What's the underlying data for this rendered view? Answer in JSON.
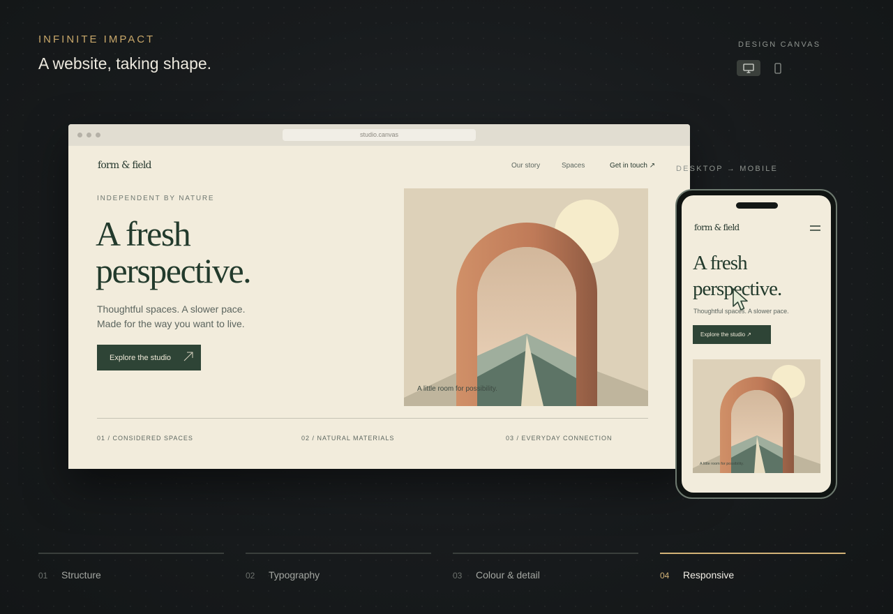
{
  "header": {
    "eyebrow": "INFINITE IMPACT",
    "headline": "A website, taking shape."
  },
  "canvas_controls": {
    "label": "DESIGN CANVAS",
    "modes": [
      {
        "icon": "desktop-icon",
        "active": true
      },
      {
        "icon": "mobile-icon",
        "active": false
      }
    ]
  },
  "desktop_preview": {
    "url": "studio.canvas",
    "site": {
      "logo": "form & field",
      "nav": [
        "Our story",
        "Spaces",
        "Get in touch ↗"
      ],
      "kicker": "INDEPENDENT BY NATURE",
      "title_line1": "A fresh",
      "title_line2": "perspective.",
      "subtitle_line1": "Thoughtful spaces. A slower pace.",
      "subtitle_line2": "Made for the way you want to live.",
      "cta": "Explore the studio",
      "caption": "A little room for possibility.",
      "features": [
        "01 / CONSIDERED SPACES",
        "02 / NATURAL MATERIALS",
        "03 / EVERYDAY CONNECTION"
      ]
    }
  },
  "transition_label": "DESKTOP → MOBILE",
  "mobile_preview": {
    "logo": "form & field",
    "title_line1": "A fresh",
    "title_line2": "perspective.",
    "subtitle": "Thoughtful spaces. A slower pace.",
    "cta": "Explore the studio ↗",
    "caption": "A little room for possibility."
  },
  "steps": [
    {
      "num": "01",
      "label": "Structure",
      "active": false
    },
    {
      "num": "02",
      "label": "Typography",
      "active": false
    },
    {
      "num": "03",
      "label": "Colour & detail",
      "active": false
    },
    {
      "num": "04",
      "label": "Responsive",
      "active": true
    }
  ],
  "colors": {
    "accent_gold": "#d2b277",
    "site_green": "#2e4436",
    "site_cream": "#f2ecdc",
    "arch_terracotta": "#c4825e"
  }
}
